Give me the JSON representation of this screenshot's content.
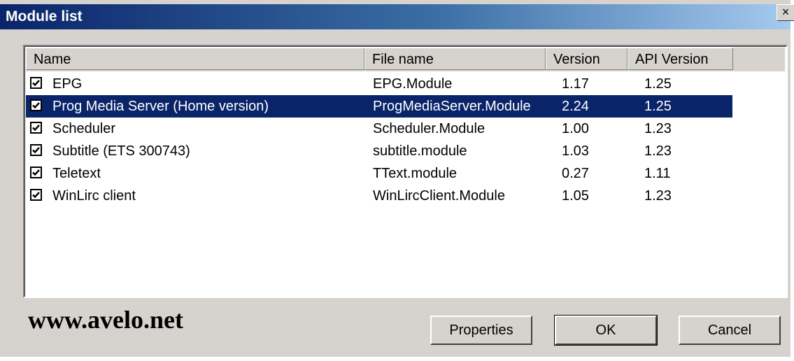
{
  "window": {
    "title": "Module list",
    "close_glyph": "×"
  },
  "columns": [
    "Name",
    "File name",
    "Version",
    "API Version"
  ],
  "rows": [
    {
      "checked": true,
      "name": "EPG",
      "file": "EPG.Module",
      "version": "1.17",
      "api": "1.25",
      "selected": false
    },
    {
      "checked": true,
      "name": "Prog Media Server (Home version)",
      "file": "ProgMediaServer.Module",
      "version": "2.24",
      "api": "1.25",
      "selected": true
    },
    {
      "checked": true,
      "name": "Scheduler",
      "file": "Scheduler.Module",
      "version": "1.00",
      "api": "1.23",
      "selected": false
    },
    {
      "checked": true,
      "name": "Subtitle (ETS 300743)",
      "file": "subtitle.module",
      "version": "1.03",
      "api": "1.23",
      "selected": false
    },
    {
      "checked": true,
      "name": "Teletext",
      "file": "TText.module",
      "version": "0.27",
      "api": "1.11",
      "selected": false
    },
    {
      "checked": true,
      "name": "WinLirc client",
      "file": "WinLircClient.Module",
      "version": "1.05",
      "api": "1.23",
      "selected": false
    }
  ],
  "watermark": "www.avelo.net",
  "buttons": {
    "properties": "Properties",
    "ok": "OK",
    "cancel": "Cancel"
  },
  "colors": {
    "selection": "#0a246a",
    "face": "#d6d3ce",
    "title_start": "#0a246a"
  },
  "icons": {
    "checkbox": "checkmark-icon",
    "close": "close-icon"
  }
}
